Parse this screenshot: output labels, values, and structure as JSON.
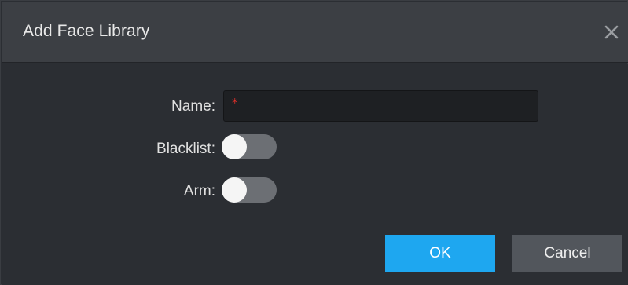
{
  "dialog": {
    "title": "Add Face Library",
    "close_icon": "close-icon"
  },
  "form": {
    "name_label": "Name:",
    "name_required_marker": "*",
    "name_value": "",
    "blacklist_label": "Blacklist:",
    "blacklist_enabled": false,
    "arm_label": "Arm:",
    "arm_enabled": false
  },
  "buttons": {
    "ok_label": "OK",
    "cancel_label": "Cancel"
  },
  "colors": {
    "accent": "#1ea7f0",
    "required": "#e0302a",
    "toggle_off": "#6c6f74"
  }
}
